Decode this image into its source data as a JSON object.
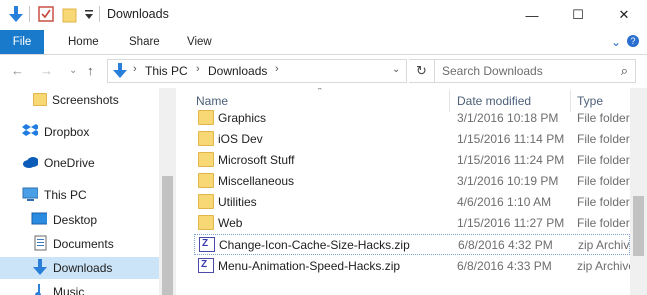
{
  "window": {
    "title": "Downloads",
    "controls": {
      "minimize": "—",
      "maximize": "☐",
      "close": "✕"
    }
  },
  "quick_access_toolbar": {
    "icons": [
      "download-arrow-icon",
      "properties-check-icon",
      "new-folder-icon",
      "dropdown-chevron-icon"
    ]
  },
  "ribbon": {
    "tabs": [
      {
        "label": "File",
        "active": true
      },
      {
        "label": "Home"
      },
      {
        "label": "Share"
      },
      {
        "label": "View"
      }
    ],
    "expand_icon": "⌄",
    "help_icon": "?"
  },
  "navigation": {
    "back": "←",
    "forward": "→",
    "recent": "⌄",
    "up": "↑"
  },
  "address_bar": {
    "crumbs": [
      "This PC",
      "Downloads"
    ],
    "dropdown": "⌄"
  },
  "search": {
    "placeholder": "Search Downloads",
    "icon": "⌕"
  },
  "nav_pane": {
    "items": [
      {
        "label": "Screenshots",
        "icon": "folder-icon"
      },
      {
        "label": "Dropbox",
        "icon": "dropbox-icon"
      },
      {
        "label": "OneDrive",
        "icon": "onedrive-icon"
      },
      {
        "label": "This PC",
        "icon": "this-pc-icon"
      },
      {
        "label": "Desktop",
        "icon": "desktop-icon"
      },
      {
        "label": "Documents",
        "icon": "documents-icon"
      },
      {
        "label": "Downloads",
        "icon": "downloads-icon",
        "selected": true
      },
      {
        "label": "Music",
        "icon": "music-icon"
      }
    ]
  },
  "file_list": {
    "columns": [
      "Name",
      "Date modified",
      "Type"
    ],
    "sort_indicator": "⌃",
    "rows": [
      {
        "name": "Graphics",
        "date": "3/1/2016 10:18 PM",
        "type": "File folder",
        "kind": "folder"
      },
      {
        "name": "iOS Dev",
        "date": "1/15/2016 11:14 PM",
        "type": "File folder",
        "kind": "folder"
      },
      {
        "name": "Microsoft Stuff",
        "date": "1/15/2016 11:24 PM",
        "type": "File folder",
        "kind": "folder"
      },
      {
        "name": "Miscellaneous",
        "date": "3/1/2016 10:19 PM",
        "type": "File folder",
        "kind": "folder"
      },
      {
        "name": "Utilities",
        "date": "4/6/2016 1:10 AM",
        "type": "File folder",
        "kind": "folder"
      },
      {
        "name": "Web",
        "date": "1/15/2016 11:27 PM",
        "type": "File folder",
        "kind": "folder"
      },
      {
        "name": "Change-Icon-Cache-Size-Hacks.zip",
        "date": "6/8/2016 4:32 PM",
        "type": "zip Archive",
        "kind": "zip",
        "focused": true
      },
      {
        "name": "Menu-Animation-Speed-Hacks.zip",
        "date": "6/8/2016 4:33 PM",
        "type": "zip Archive",
        "kind": "zip"
      }
    ]
  }
}
